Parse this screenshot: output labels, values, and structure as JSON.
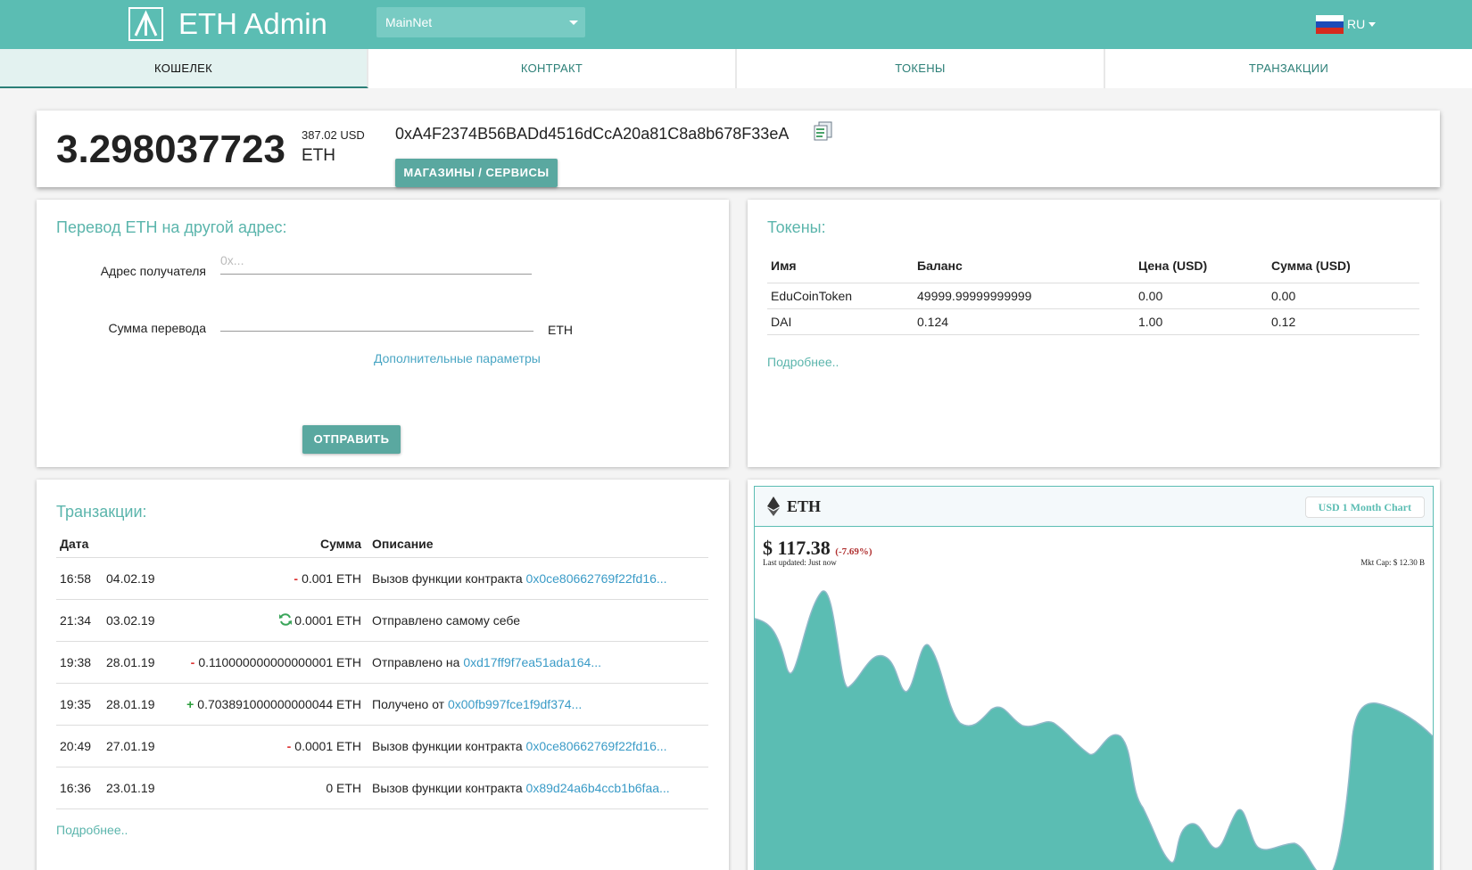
{
  "header": {
    "app_title": "ETH Admin",
    "network": "MainNet",
    "language": "RU",
    "brand_color": "#5bbdb3"
  },
  "tabs": [
    {
      "label": "КОШЕЛЕК",
      "active": true
    },
    {
      "label": "КОНТРАКТ",
      "active": false
    },
    {
      "label": "ТОКЕНЫ",
      "active": false
    },
    {
      "label": "ТРАНЗАКЦИИ",
      "active": false
    }
  ],
  "balance": {
    "amount": "3.298037723",
    "usd": "387.02 USD",
    "unit": "ETH",
    "address": "0xA4F2374B56BADd4516dCcA20a81C8a8b678F33eA",
    "shops_button": "МАГАЗИНЫ / СЕРВИСЫ"
  },
  "transfer": {
    "title": "Перевод ETH на другой адрес:",
    "recipient_label": "Адрес получателя",
    "recipient_placeholder": "0x...",
    "amount_label": "Сумма перевода",
    "amount_unit": "ETH",
    "advanced_link": "Дополнительные параметры",
    "send_button": "ОТПРАВИТЬ"
  },
  "tokens": {
    "title": "Токены:",
    "columns": [
      "Имя",
      "Баланс",
      "Цена (USD)",
      "Сумма (USD)"
    ],
    "rows": [
      [
        "EduCoinToken",
        "49999.99999999999",
        "0.00",
        "0.00"
      ],
      [
        "DAI",
        "0.124",
        "1.00",
        "0.12"
      ]
    ],
    "more_link": "Подробнее.."
  },
  "transactions": {
    "title": "Транзакции:",
    "columns": {
      "date": "Дата",
      "amount": "Сумма",
      "description": "Описание"
    },
    "rows": [
      {
        "time": "16:58",
        "date": "04.02.19",
        "sign": "-",
        "amount": "0.001 ETH",
        "desc": "Вызов функции контракта",
        "link": "0x0ce80662769f22fd16..."
      },
      {
        "time": "21:34",
        "date": "03.02.19",
        "sign": "self",
        "amount": "0.0001 ETH",
        "desc": "Отправлено самому себе",
        "link": ""
      },
      {
        "time": "19:38",
        "date": "28.01.19",
        "sign": "-",
        "amount": "0.110000000000000001 ETH",
        "desc": "Отправлено на",
        "link": "0xd17ff9f7ea51ada164..."
      },
      {
        "time": "19:35",
        "date": "28.01.19",
        "sign": "+",
        "amount": "0.703891000000000044 ETH",
        "desc": "Получено от",
        "link": "0x00fb997fce1f9df374..."
      },
      {
        "time": "20:49",
        "date": "27.01.19",
        "sign": "-",
        "amount": "0.0001 ETH",
        "desc": "Вызов функции контракта",
        "link": "0x0ce80662769f22fd16..."
      },
      {
        "time": "16:36",
        "date": "23.01.19",
        "sign": "",
        "amount": "0 ETH",
        "desc": "Вызов функции контракта",
        "link": "0x89d24a6b4ccb1b6faa..."
      }
    ],
    "more_link": "Подробнее.."
  },
  "price_widget": {
    "coin": "ETH",
    "period_button": "USD 1 Month Chart",
    "price": "$ 117.38",
    "change": "(-7.69%)",
    "updated": "Last updated: Just now",
    "mkt_cap": "Mkt Cap: $ 12.30 B",
    "fill_color": "#5bbdb3"
  }
}
